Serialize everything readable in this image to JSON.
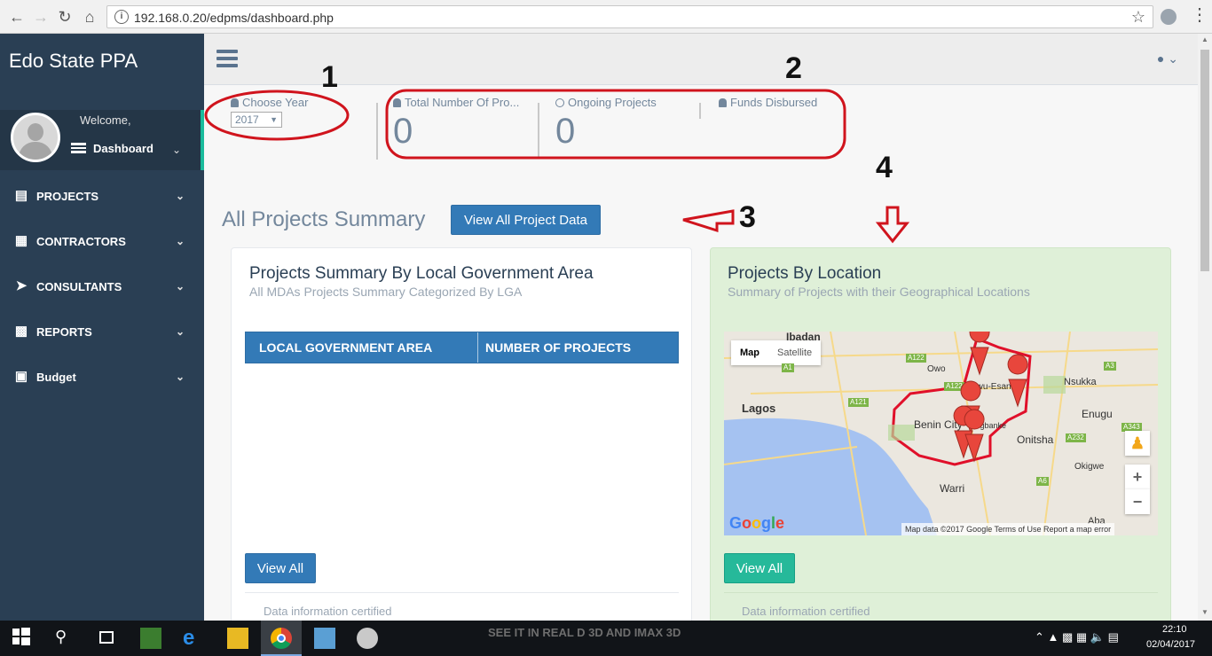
{
  "browser": {
    "url": "192.168.0.20/edpms/dashboard.php"
  },
  "sidebar": {
    "brand": "Edo State PPA",
    "welcome": "Welcome,",
    "dashboard": "Dashboard",
    "items": [
      {
        "label": "PROJECTS",
        "icon": "table-icon"
      },
      {
        "label": "CONTRACTORS",
        "icon": "building-icon"
      },
      {
        "label": "CONSULTANTS",
        "icon": "paper-plane-icon"
      },
      {
        "label": "REPORTS",
        "icon": "bar-chart-icon"
      },
      {
        "label": "Budget",
        "icon": "money-icon"
      }
    ]
  },
  "tiles": {
    "year_label": "Choose Year",
    "year_value": "2017",
    "total_label": "Total Number Of Pro...",
    "total_value": "0",
    "ongoing_label": "Ongoing Projects",
    "ongoing_value": "0",
    "funds_label": "Funds Disbursed"
  },
  "annotations": [
    "1",
    "2",
    "3",
    "4"
  ],
  "section": {
    "title": "All Projects Summary",
    "view_all_button": "View All Project Data"
  },
  "lga_panel": {
    "title": "Projects Summary By Local Government Area",
    "subtitle": "All MDAs Projects Summary Categorized By LGA",
    "columns": [
      "LOCAL GOVERNMENT AREA",
      "NUMBER OF PROJECTS"
    ],
    "button": "View All",
    "footer": "Data information certified"
  },
  "location_panel": {
    "title": "Projects By Location",
    "subtitle": "Summary of Projects with their Geographical Locations",
    "button": "View All",
    "footer": "Data information certified",
    "map": {
      "type_map": "Map",
      "type_satellite": "Satellite",
      "places": [
        "Ibadan",
        "Owo",
        "Ewu-Esan",
        "Nsukka",
        "Lagos",
        "Benin City",
        "Ugbanke",
        "Onitsha",
        "Enugu",
        "Warri",
        "Okigwe",
        "Aba"
      ],
      "roads": [
        "A122",
        "A1",
        "A122",
        "A121",
        "A3",
        "A343",
        "A232",
        "A6"
      ],
      "zoom_in": "+",
      "zoom_out": "−",
      "google": "Google",
      "attribution": "Map data ©2017 Google   Terms of Use   Report a map error"
    }
  },
  "taskbar": {
    "time": "22:10",
    "date": "02/04/2017",
    "banner": "SEE IT IN REAL D 3D AND IMAX 3D"
  },
  "colors": {
    "sidebar": "#2a3f54",
    "accent_green": "#26b99a",
    "primary_blue": "#337ab7",
    "annotation_red": "#d0141d"
  }
}
